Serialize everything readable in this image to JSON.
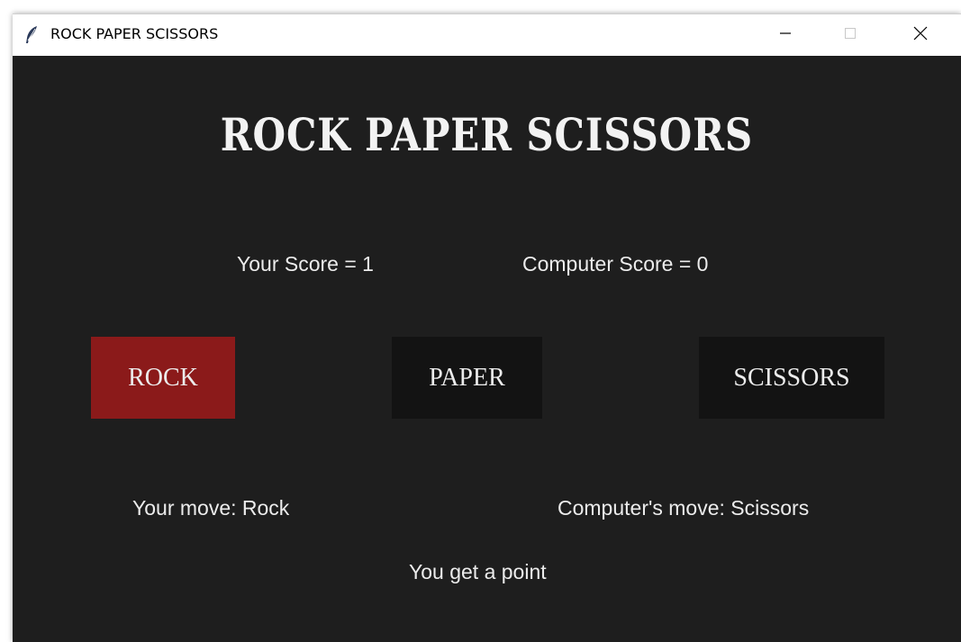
{
  "window": {
    "title": "ROCK PAPER SCISSORS",
    "controls": {
      "minimize_icon": "minimize-icon",
      "maximize_icon": "maximize-icon",
      "close_icon": "close-icon"
    }
  },
  "game": {
    "title": "ROCK PAPER SCISSORS",
    "your_score": "Your Score = 1",
    "computer_score": "Computer Score = 0",
    "buttons": {
      "rock": "ROCK",
      "paper": "PAPER",
      "scissors": "SCISSORS"
    },
    "your_move": "Your move: Rock",
    "computer_move": "Computer's move: Scissors",
    "result": "You get a point"
  },
  "colors": {
    "background": "#1e1e1e",
    "selected_button": "#8b1a1a",
    "button": "#131313",
    "text": "#ececec"
  }
}
